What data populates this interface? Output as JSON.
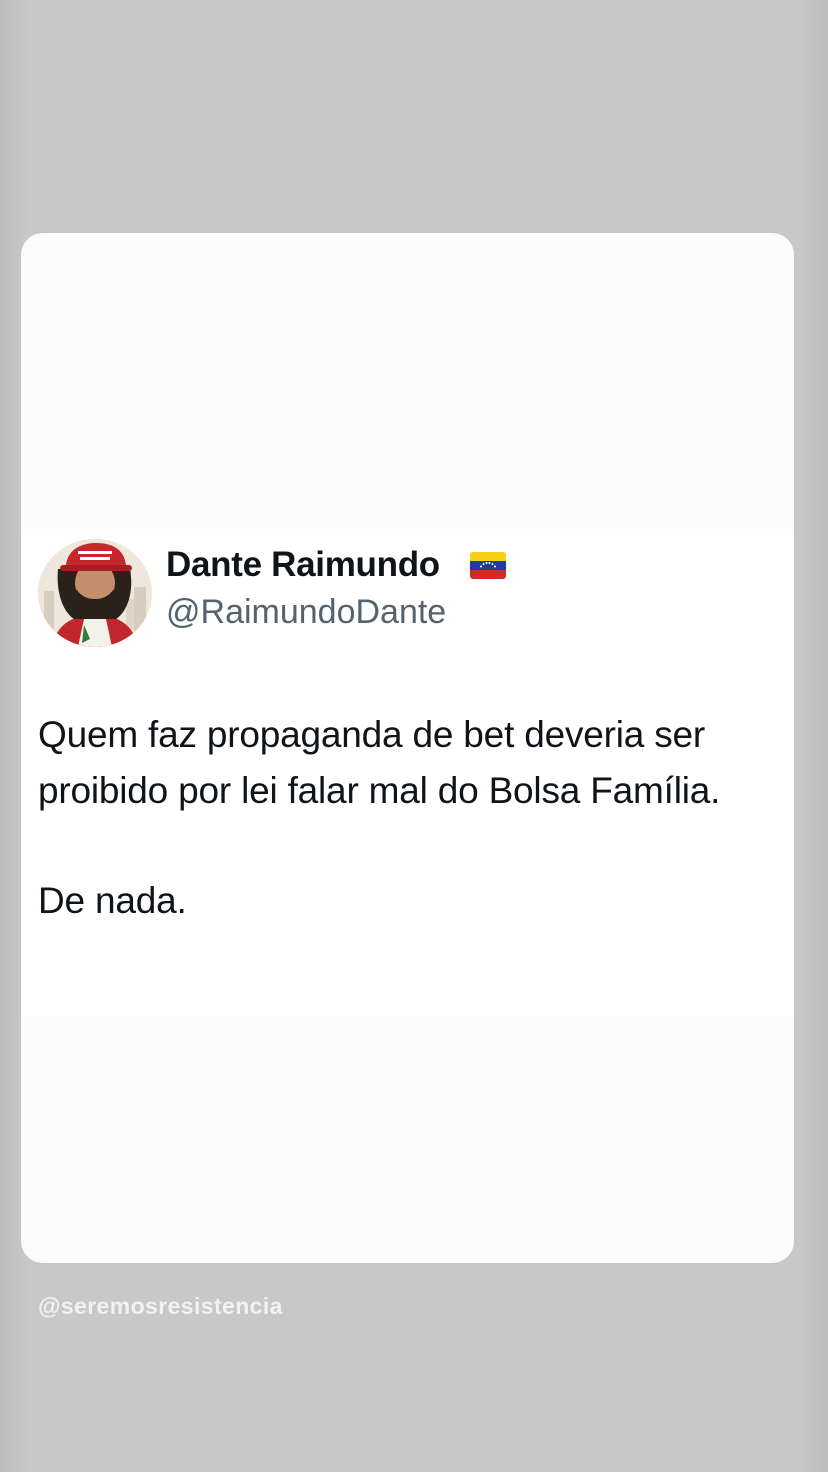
{
  "post": {
    "author_name": "Dante Raimundo",
    "author_flag_icon": "venezuela-flag-icon",
    "author_handle": "@RaimundoDante",
    "text_line_1": "Quem faz propaganda de bet deveria ser proibido por lei falar mal do Bolsa Família.",
    "text_line_2": "De nada."
  },
  "watermark": {
    "text": "@seremosresistencia"
  },
  "colors": {
    "background": "#c9c8c8",
    "card": "#ffffff",
    "name_text": "#0f1419",
    "handle_text": "#536471",
    "watermark_text": "#f2f2f2"
  }
}
